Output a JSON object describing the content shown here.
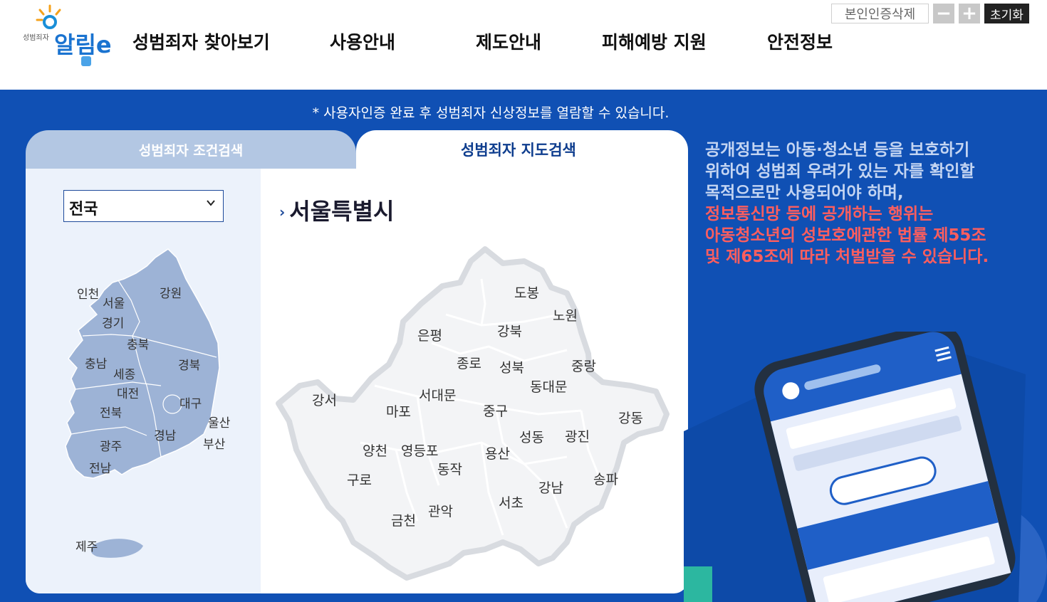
{
  "header": {
    "logo": {
      "small_text": "성범죄자",
      "main_text": "알림e"
    },
    "nav": [
      {
        "label": "성범죄자 찾아보기"
      },
      {
        "label": "사용안내"
      },
      {
        "label": "제도안내"
      },
      {
        "label": "피해예방 지원"
      },
      {
        "label": "안전정보"
      }
    ],
    "utility": {
      "cert_delete": "본인인증삭제",
      "zoom_out": "−",
      "zoom_in": "+",
      "reset": "초기화"
    }
  },
  "notice": "* 사용자인증 완료 후 성범죄자 신상정보를 열람할 수 있습니다.",
  "tabs": [
    {
      "label": "성범죄자 조건검색",
      "active": false
    },
    {
      "label": "성범죄자 지도검색",
      "active": true
    }
  ],
  "region_select": {
    "value": "전국"
  },
  "korea_regions": [
    "인천",
    "서울",
    "경기",
    "강원",
    "충북",
    "충남",
    "세종",
    "대전",
    "경북",
    "대구",
    "전북",
    "울산",
    "경남",
    "부산",
    "광주",
    "전남",
    "제주"
  ],
  "seoul": {
    "title": "서울특별시",
    "districts": [
      "도봉",
      "노원",
      "은평",
      "강북",
      "종로",
      "성북",
      "중랑",
      "서대문",
      "동대문",
      "강서",
      "마포",
      "중구",
      "강동",
      "성동",
      "광진",
      "양천",
      "영등포",
      "용산",
      "동작",
      "구로",
      "송파",
      "강남",
      "서초",
      "관악",
      "금천"
    ]
  },
  "warning": {
    "normal": [
      "공개정보는 아동·청소년 등을 보호하기",
      "위하여 성범죄 우려가 있는 자를 확인할",
      "목적으로만 사용되어야 하며,"
    ],
    "highlight": [
      "정보통신망 등에 공개하는 행위는",
      "아동청소년의 성보호에관한 법률 제55조",
      "및 제65조에 따라 처벌받을 수 있습니다."
    ]
  },
  "colors": {
    "brand_blue": "#1050b4",
    "tab_inactive": "#b3c7e3",
    "map_fill": "#9db3d6",
    "warning_red": "#ff5e5e"
  }
}
